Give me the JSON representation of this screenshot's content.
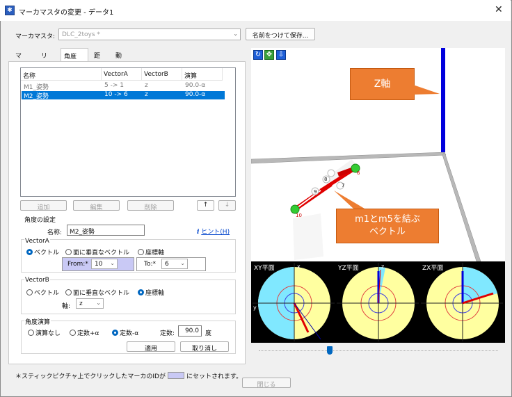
{
  "window": {
    "title": "マーカマスタの変更 - データ1",
    "close": "✕",
    "app_icon": "app-icon"
  },
  "master": {
    "label": "マーカマスタ:",
    "value": "DLC_2toys *",
    "save_button": "名前をつけて保存..."
  },
  "tabs": [
    "マーカ",
    "リンク",
    "角度",
    "距離",
    "動作分析"
  ],
  "list": {
    "headers": [
      "名称",
      "VectorA",
      "VectorB",
      "演算"
    ],
    "rows": [
      [
        "M1_姿勢",
        "5 -> 1",
        "z",
        "90.0-α"
      ],
      [
        "M2_姿勢",
        "10 -> 6",
        "z",
        "90.0-α"
      ]
    ]
  },
  "list_buttons": {
    "add": "追加",
    "edit": "編集",
    "delete": "削除",
    "up": "↑",
    "down": "↓"
  },
  "settings": {
    "title": "角度の設定",
    "name_label": "名称:",
    "name_value": "M2_姿勢",
    "hint": "ヒント(H)",
    "vector_a": {
      "title": "VectorA",
      "opt1": "ベクトル",
      "opt2": "面に垂直なベクトル",
      "opt3": "座標軸",
      "from_label": "From:*",
      "from_value": "10",
      "to_label": "To:*",
      "to_value": "6"
    },
    "vector_b": {
      "title": "VectorB",
      "opt1": "ベクトル",
      "opt2": "面に垂直なベクトル",
      "opt3": "座標軸",
      "axis_label": "軸:",
      "axis_value": "z"
    },
    "calc": {
      "title": "角度演算",
      "opt1": "演算なし",
      "opt2": "定数+α",
      "opt3": "定数-α",
      "const_label": "定数:",
      "const_value": "90.0",
      "unit": "度"
    },
    "apply": "適用",
    "cancel": "取り消し"
  },
  "viewer": {
    "callout_z": "Z軸",
    "callout_vec_line1": "m1とm5を結ぶ",
    "callout_vec_line2": "ベクトル",
    "marker_labels": [
      "10",
      "9",
      "8",
      "7",
      "6"
    ],
    "toolbar_icons": [
      "rotate-icon",
      "move-icon",
      "down-arrow-icon"
    ]
  },
  "views": {
    "xy": "XY平面",
    "yz": "YZ平面",
    "zx": "ZX平面",
    "x": "x",
    "y": "y",
    "z": "z"
  },
  "footer": {
    "note": "＊スティックピクチャ上でクリックしたマーカのIDが",
    "note_suffix": "にセットされます。",
    "close": "閉じる"
  },
  "colors": {
    "selection": "#0078d7",
    "callout": "#ed7d31",
    "axis_blue": "#0000dd",
    "vector_red": "#e00000",
    "marker_green": "#33cc33"
  }
}
